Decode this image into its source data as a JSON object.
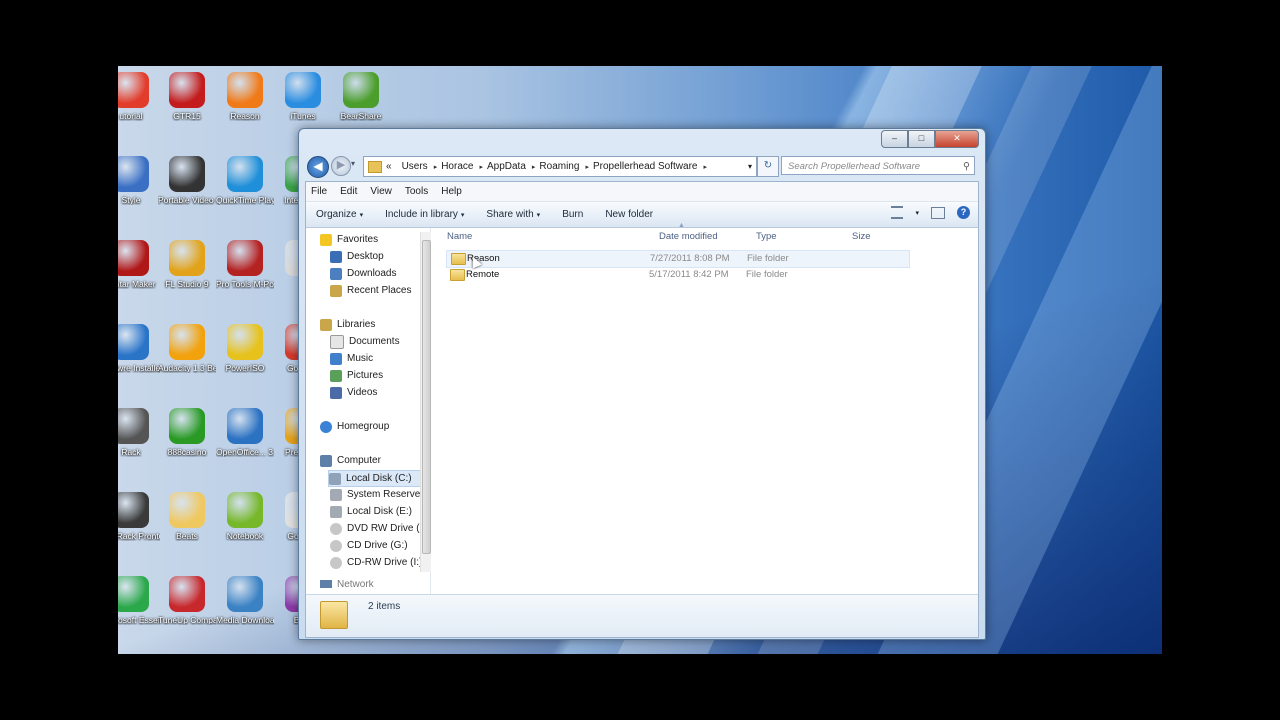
{
  "desktop_icons": [
    {
      "label": "utorial",
      "color": "#e23c2a"
    },
    {
      "label": "GTR15",
      "color": "#c41c1c"
    },
    {
      "label": "Reason",
      "color": "#f07a18"
    },
    {
      "label": "iTunes",
      "color": "#2b8de0"
    },
    {
      "label": "BearShare",
      "color": "#4b9e2b"
    },
    {
      "label": "Style",
      "color": "#3a6fc4"
    },
    {
      "label": "Portable Video Converter",
      "color": "#333333"
    },
    {
      "label": "QuickTime Player",
      "color": "#1e8fd8"
    },
    {
      "label": "Intel Ense",
      "color": "#3aa34a"
    },
    {
      "label": "Guitar Maker",
      "color": "#b01818"
    },
    {
      "label": "FL Studio 9",
      "color": "#e2a31a"
    },
    {
      "label": "Pro Tools M-Powered",
      "color": "#b52222"
    },
    {
      "label": "le",
      "color": "#d9d9d9"
    },
    {
      "label": "Softwre Installer",
      "color": "#2a74c8"
    },
    {
      "label": "Audacity 1.3 Beta (Unic...",
      "color": "#f2a20c"
    },
    {
      "label": "PowerISO",
      "color": "#e7c21c"
    },
    {
      "label": "Goo Chr",
      "color": "#d23a2e"
    },
    {
      "label": "Rack",
      "color": "#555555"
    },
    {
      "label": "888casino",
      "color": "#2a9a25"
    },
    {
      "label": "OpenOffice... 3.3",
      "color": "#2c72c2"
    },
    {
      "label": "Prem Pro",
      "color": "#e5a31c"
    },
    {
      "label": "SG Rack Pronto",
      "color": "#3a3a3a"
    },
    {
      "label": "Beats",
      "color": "#f0c860"
    },
    {
      "label": "Notebook",
      "color": "#76b82a"
    },
    {
      "label": "Goo Ste",
      "color": "#e0e0e0"
    },
    {
      "label": "Microsoft Essen",
      "color": "#2aa84a"
    },
    {
      "label": "TuneUp Companion",
      "color": "#c7282c"
    },
    {
      "label": "Media Downloader",
      "color": "#3b82c4"
    },
    {
      "label": "BiTS",
      "color": "#8b3aa8"
    }
  ],
  "window": {
    "caption": {
      "min": "–",
      "max": "□",
      "close": "✕"
    },
    "nav": {
      "back": "◀",
      "forward": "▶",
      "drop": "▾"
    },
    "breadcrumb": [
      "«",
      "Users",
      "Horace",
      "AppData",
      "Roaming",
      "Propellerhead Software"
    ],
    "breadcrumb_sep": "▸",
    "address_drop": "▾",
    "refresh": "↻",
    "search_placeholder": "Search Propellerhead Software",
    "search_icon": "⚲",
    "menu": [
      "File",
      "Edit",
      "View",
      "Tools",
      "Help"
    ],
    "toolbar": {
      "organize": "Organize",
      "include": "Include in library",
      "share": "Share with",
      "burn": "Burn",
      "new_folder": "New folder",
      "dd": "▾"
    },
    "nav_pane": {
      "favorites": "Favorites",
      "desktop": "Desktop",
      "downloads": "Downloads",
      "recent": "Recent Places",
      "libraries": "Libraries",
      "documents": "Documents",
      "music": "Music",
      "pictures": "Pictures",
      "videos": "Videos",
      "homegroup": "Homegroup",
      "computer": "Computer",
      "local_c": "Local Disk (C:)",
      "system_reserved": "System Reserved",
      "local_e": "Local Disk (E:)",
      "dvd": "DVD RW Drive (F:",
      "cd_g": "CD Drive (G:)",
      "cdrw": "CD-RW Drive (I:)",
      "network": "Network"
    },
    "columns": {
      "name": "Name",
      "date": "Date modified",
      "type": "Type",
      "size": "Size"
    },
    "files": [
      {
        "name": "Reason",
        "date": "7/27/2011 8:08 PM",
        "type": "File folder"
      },
      {
        "name": "Remote",
        "date": "5/17/2011 8:42 PM",
        "type": "File folder"
      }
    ],
    "status_count": "2 items"
  }
}
